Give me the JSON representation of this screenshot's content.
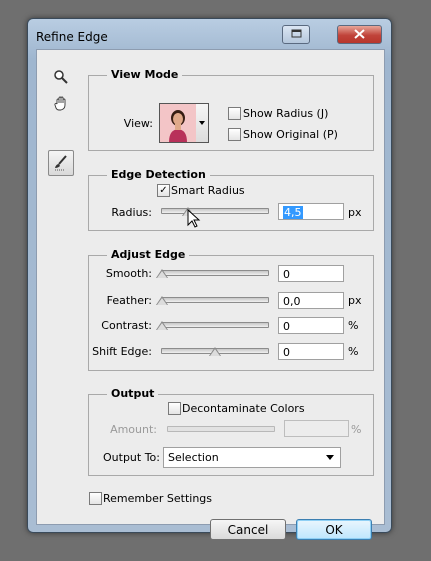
{
  "window": {
    "title": "Refine Edge"
  },
  "colors": {
    "accent": "#3399ff",
    "close_button": "#c0433a"
  },
  "tools": [
    "zoom-tool",
    "hand-tool",
    "refine-radius-tool"
  ],
  "view_mode": {
    "legend": "View Mode",
    "view_label": "View:",
    "show_radius_label": "Show Radius (J)",
    "show_radius_checked": false,
    "show_original_label": "Show Original (P)",
    "show_original_checked": false
  },
  "edge_detection": {
    "legend": "Edge Detection",
    "smart_radius_label": "Smart Radius",
    "smart_radius_checked": true,
    "checkmark": "✓",
    "radius_label": "Radius:",
    "radius_value": "4,5",
    "radius_unit": "px",
    "radius_slider_fraction": 0.18
  },
  "adjust_edge": {
    "legend": "Adjust Edge",
    "smooth_label": "Smooth:",
    "smooth_value": "0",
    "smooth_slider_fraction": 0,
    "feather_label": "Feather:",
    "feather_value": "0,0",
    "feather_unit": "px",
    "feather_slider_fraction": 0,
    "contrast_label": "Contrast:",
    "contrast_value": "0",
    "contrast_unit": "%",
    "contrast_slider_fraction": 0,
    "shift_label": "Shift Edge:",
    "shift_value": "0",
    "shift_unit": "%",
    "shift_slider_fraction": 0.5
  },
  "output": {
    "legend": "Output",
    "decontaminate_label": "Decontaminate Colors",
    "decontaminate_checked": false,
    "amount_label": "Amount:",
    "amount_unit": "%",
    "output_to_label": "Output To:",
    "output_to_value": "Selection"
  },
  "remember_label": "Remember Settings",
  "remember_checked": false,
  "cancel_label": "Cancel",
  "ok_label": "OK"
}
